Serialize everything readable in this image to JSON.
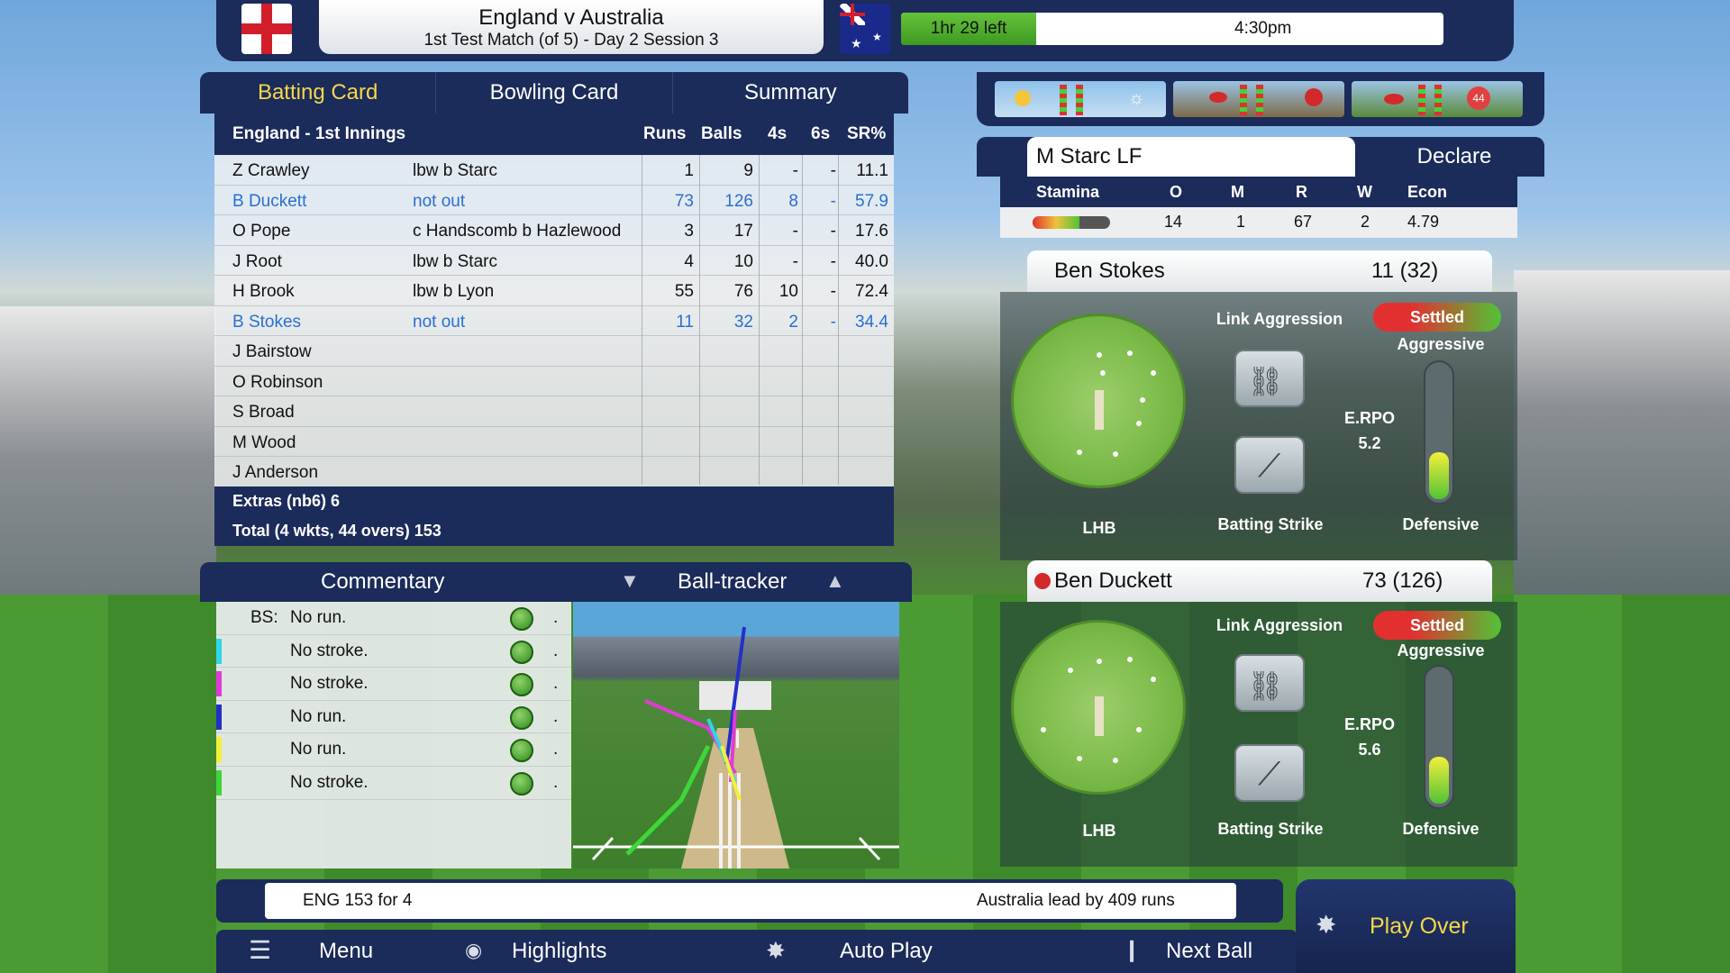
{
  "header": {
    "title": "England v Australia",
    "subtitle": "1st Test Match (of 5) - Day 2 Session 3",
    "time_left": "1hr 29 left",
    "clock": "4:30pm",
    "home_flag": "england-flag",
    "away_flag": "australia-flag"
  },
  "tabs": [
    {
      "label": "Batting Card",
      "active": true
    },
    {
      "label": "Bowling Card",
      "active": false
    },
    {
      "label": "Summary",
      "active": false
    }
  ],
  "batting_card": {
    "innings": "England - 1st Innings",
    "columns": [
      "Runs",
      "Balls",
      "4s",
      "6s",
      "SR%"
    ],
    "rows": [
      {
        "name": "Z Crawley",
        "dismissal": "lbw b Starc",
        "runs": "1",
        "balls": "9",
        "fours": "-",
        "sixes": "-",
        "sr": "11.1",
        "not_out": false
      },
      {
        "name": "B Duckett",
        "dismissal": "not out",
        "runs": "73",
        "balls": "126",
        "fours": "8",
        "sixes": "-",
        "sr": "57.9",
        "not_out": true
      },
      {
        "name": "O Pope",
        "dismissal": "c Handscomb b Hazlewood",
        "runs": "3",
        "balls": "17",
        "fours": "-",
        "sixes": "-",
        "sr": "17.6",
        "not_out": false
      },
      {
        "name": "J Root",
        "dismissal": "lbw b Starc",
        "runs": "4",
        "balls": "10",
        "fours": "-",
        "sixes": "-",
        "sr": "40.0",
        "not_out": false
      },
      {
        "name": "H Brook",
        "dismissal": "lbw b Lyon",
        "runs": "55",
        "balls": "76",
        "fours": "10",
        "sixes": "-",
        "sr": "72.4",
        "not_out": false
      },
      {
        "name": "B Stokes",
        "dismissal": "not out",
        "runs": "11",
        "balls": "32",
        "fours": "2",
        "sixes": "-",
        "sr": "34.4",
        "not_out": true
      },
      {
        "name": "J Bairstow",
        "dismissal": "",
        "runs": "",
        "balls": "",
        "fours": "",
        "sixes": "",
        "sr": "",
        "not_out": false
      },
      {
        "name": "O Robinson",
        "dismissal": "",
        "runs": "",
        "balls": "",
        "fours": "",
        "sixes": "",
        "sr": "",
        "not_out": false
      },
      {
        "name": "S Broad",
        "dismissal": "",
        "runs": "",
        "balls": "",
        "fours": "",
        "sixes": "",
        "sr": "",
        "not_out": false
      },
      {
        "name": "M Wood",
        "dismissal": "",
        "runs": "",
        "balls": "",
        "fours": "",
        "sixes": "",
        "sr": "",
        "not_out": false
      },
      {
        "name": "J Anderson",
        "dismissal": "",
        "runs": "",
        "balls": "",
        "fours": "",
        "sixes": "",
        "sr": "",
        "not_out": false
      }
    ],
    "extras": "Extras (nb6) 6",
    "total": "Total (4 wkts, 44 overs) 153"
  },
  "commentary": {
    "title": "Commentary",
    "tracker_title": "Ball-tracker",
    "rows": [
      {
        "prefix": "BS:",
        "text": "No run.",
        "marker_color": ""
      },
      {
        "prefix": "",
        "text": "No stroke.",
        "marker_color": "#2fd6e6"
      },
      {
        "prefix": "",
        "text": "No stroke.",
        "marker_color": "#e23ad6"
      },
      {
        "prefix": "",
        "text": "No run.",
        "marker_color": "#2230c8"
      },
      {
        "prefix": "",
        "text": "No run.",
        "marker_color": "#f3f03a"
      },
      {
        "prefix": "",
        "text": "No stroke.",
        "marker_color": "#3ed63a"
      }
    ],
    "dot": "."
  },
  "status": {
    "score": "ENG  153 for 4",
    "lead": "Australia lead by 409 runs"
  },
  "bottom_bar": {
    "menu": "Menu",
    "highlights": "Highlights",
    "auto_play": "Auto Play",
    "next_ball": "Next Ball",
    "play_over": "Play Over"
  },
  "bowler": {
    "name": "M Starc LF",
    "declare": "Declare",
    "columns": [
      "Stamina",
      "O",
      "M",
      "R",
      "W",
      "Econ"
    ],
    "overs": "14",
    "maidens": "1",
    "runs": "67",
    "wickets": "2",
    "econ": "4.79",
    "stamina_level": 0.6
  },
  "batters": [
    {
      "name": "Ben Stokes",
      "score": "11 (32)",
      "hand": "LHB",
      "link_aggression": "Link Aggression",
      "mode": "Settled",
      "aggressive": "Aggressive",
      "defensive": "Defensive",
      "batting_strike": "Batting Strike",
      "erpo_label": "E.RPO",
      "erpo": "5.2",
      "meter_level": 0.35,
      "on_strike": false
    },
    {
      "name": "Ben Duckett",
      "score": "73 (126)",
      "hand": "LHB",
      "link_aggression": "Link Aggression",
      "mode": "Settled",
      "aggressive": "Aggressive",
      "defensive": "Defensive",
      "batting_strike": "Batting Strike",
      "erpo_label": "E.RPO",
      "erpo": "5.6",
      "meter_level": 0.35,
      "on_strike": true
    }
  ],
  "colors": {
    "navy": "#1b2b5a",
    "active_tab": "#f5d74a",
    "not_out": "#2a6fd0",
    "play_over": "#f5d74a"
  }
}
